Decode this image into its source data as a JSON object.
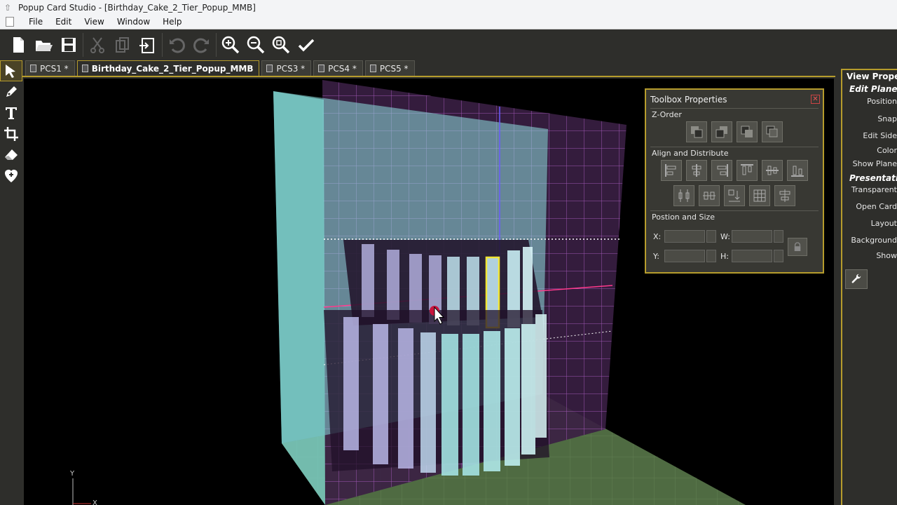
{
  "window": {
    "title": "Popup Card Studio - [Birthday_Cake_2_Tier_Popup_MMB]"
  },
  "menu": {
    "items": [
      "File",
      "Edit",
      "View",
      "Window",
      "Help"
    ]
  },
  "toolbar": {
    "buttons": [
      "new-file-icon",
      "open-folder-icon",
      "save-icon",
      "cut-icon",
      "copy-icon",
      "export-icon",
      "undo-icon",
      "redo-icon",
      "zoom-in-icon",
      "zoom-out-icon",
      "zoom-fit-icon",
      "check-icon"
    ]
  },
  "left_tools": [
    "select-arrow-icon",
    "pen-icon",
    "text-icon",
    "crop-icon",
    "eraser-icon",
    "heart-add-icon"
  ],
  "tabs": [
    {
      "label": "PCS1 *",
      "active": false
    },
    {
      "label": "Birthday_Cake_2_Tier_Popup_MMB",
      "active": true
    },
    {
      "label": "PCS3 *",
      "active": false
    },
    {
      "label": "PCS4 *",
      "active": false
    },
    {
      "label": "PCS5 *",
      "active": false
    }
  ],
  "viewport": {
    "axis_y": "Y",
    "axis_x": "X"
  },
  "toolbox": {
    "title": "Toolbox Properties",
    "z_order_title": "Z-Order",
    "align_title": "Align and Distribute",
    "position_title": "Postion and Size",
    "x_label": "X:",
    "y_label": "Y:",
    "w_label": "W:",
    "h_label": "H:"
  },
  "right_panel": {
    "title": "View Propert",
    "edit_plane": "Edit Plane",
    "items_edit": [
      "Position",
      "Snap",
      "Edit Side",
      "Color",
      "Show Plane"
    ],
    "presentation": "Presentation",
    "items_presentation": [
      "Transparent",
      "Open Card",
      "Layout",
      "Background",
      "Show"
    ]
  },
  "colors": {
    "accent": "#b69c2c",
    "grid": "#b060c8",
    "panel_cyan": "#8fe0e0",
    "floor": "#4f6b42"
  }
}
